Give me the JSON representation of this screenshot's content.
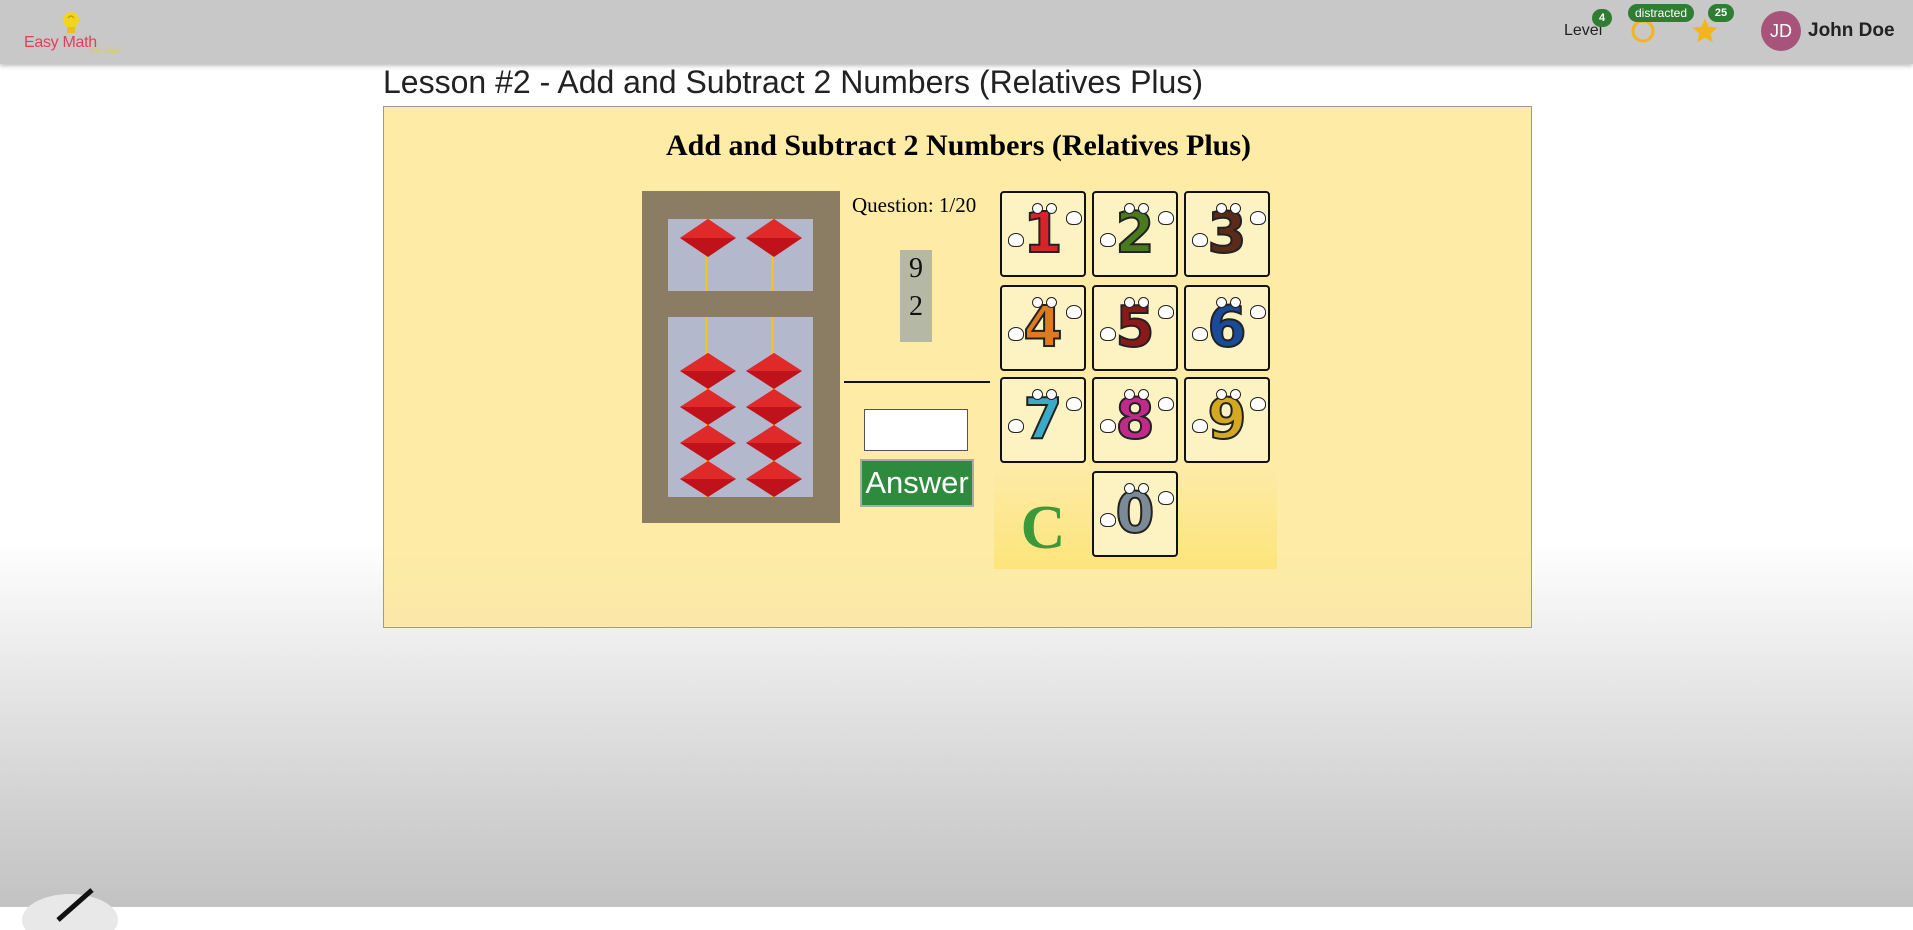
{
  "app": {
    "logo_text": "Easy Math",
    "logo_sub": "for kids"
  },
  "header": {
    "level_label": "Level",
    "level_value": "4",
    "status_badge": "distracted",
    "stars_count": "25",
    "avatar_initials": "JD",
    "user_name": "John Doe",
    "status_icon": "ring-icon",
    "stars_icon": "star-icon"
  },
  "lesson": {
    "title": "Lesson #2 - Add and Subtract 2 Numbers (Relatives Plus)",
    "panel_title": "Add and Subtract 2 Numbers (Relatives Plus)",
    "question_label": "Question: 1/20",
    "numbers": [
      "9",
      "2"
    ],
    "answer_value": "",
    "answer_button": "Answer"
  },
  "keypad": {
    "keys": [
      {
        "digit": "1",
        "color": "#d8232a"
      },
      {
        "digit": "2",
        "color": "#4a7a1e"
      },
      {
        "digit": "3",
        "color": "#5a2a1a"
      },
      {
        "digit": "4",
        "color": "#e07a20"
      },
      {
        "digit": "5",
        "color": "#8a1a1a"
      },
      {
        "digit": "6",
        "color": "#1a4a9a"
      },
      {
        "digit": "7",
        "color": "#3aaac8"
      },
      {
        "digit": "8",
        "color": "#c02a8a"
      },
      {
        "digit": "9",
        "color": "#d4a820"
      },
      {
        "digit": "0",
        "color": "#7a8a96"
      }
    ],
    "clear_label": "C",
    "clear_color": "#3a9a3a"
  },
  "colors": {
    "topbar": "#c8c8c8",
    "panel_bg": "#fdeba6",
    "answer_button_bg": "#2e8b3e",
    "badge_green": "#2e7d32",
    "avatar_bg": "#a8547a",
    "bead_red": "#c0121a"
  },
  "abacus": {
    "rods": 2,
    "upper_beads_per_rod": 1,
    "lower_beads_per_rod": 4,
    "icon": "abacus-icon"
  },
  "corner_tool": "pencil-icon"
}
